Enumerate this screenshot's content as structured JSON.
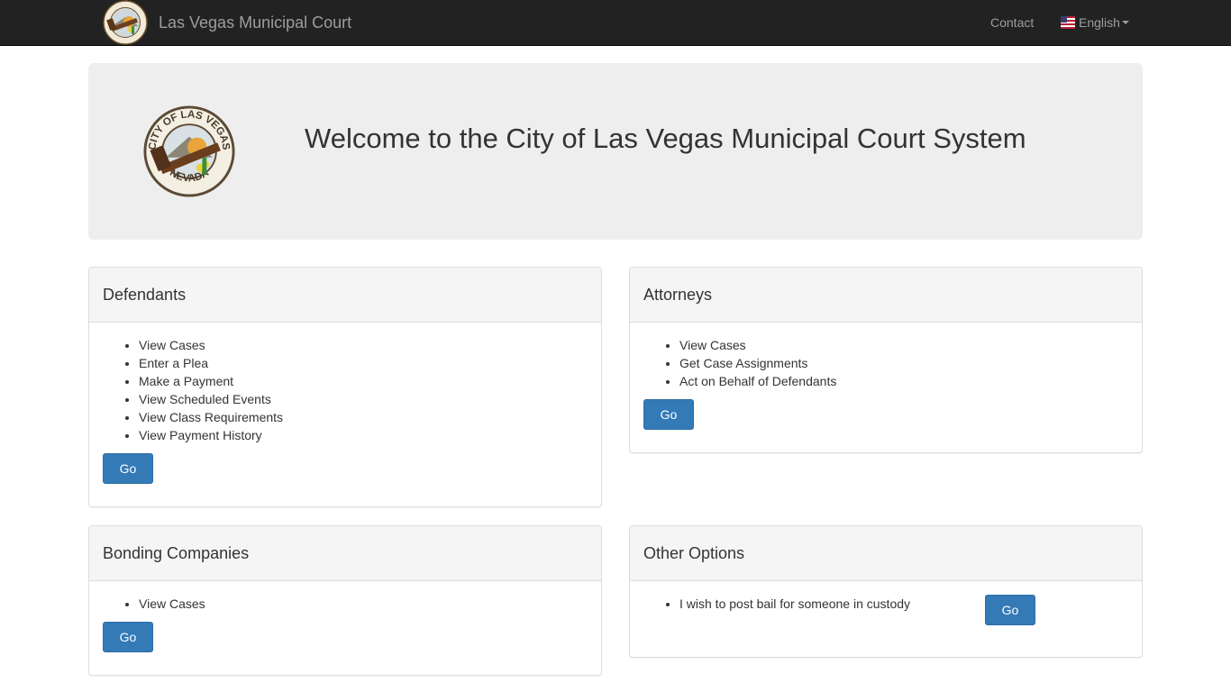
{
  "navbar": {
    "brand": "Las Vegas Municipal Court",
    "contact": "Contact",
    "language": "English"
  },
  "jumbotron": {
    "title": "Welcome to the City of Las Vegas Municipal Court System",
    "seal_top": "CITY OF LAS VEGAS",
    "seal_bottom": "NEVADA"
  },
  "panels": {
    "defendants": {
      "title": "Defendants",
      "items": [
        "View Cases",
        "Enter a Plea",
        "Make a Payment",
        "View Scheduled Events",
        "View Class Requirements",
        "View Payment History"
      ],
      "button": "Go »"
    },
    "attorneys": {
      "title": "Attorneys",
      "items": [
        "View Cases",
        "Get Case Assignments",
        "Act on Behalf of Defendants"
      ],
      "button": "Go »"
    },
    "bonding": {
      "title": "Bonding Companies",
      "items": [
        "View Cases"
      ],
      "button": "Go »"
    },
    "other": {
      "title": "Other Options",
      "items": [
        "I wish to post bail for someone in custody"
      ],
      "button": "Go »"
    }
  },
  "colors": {
    "navbar_bg": "#222222",
    "nav_text": "#9d9d9d",
    "jumbotron_bg": "#eeeeee",
    "button_primary": "#337ab7",
    "panel_heading_bg": "#f5f5f5"
  },
  "icons": {
    "brand_logo": "city-seal-icon",
    "language_flag": "us-flag-icon",
    "dropdown": "caret-down-icon"
  }
}
